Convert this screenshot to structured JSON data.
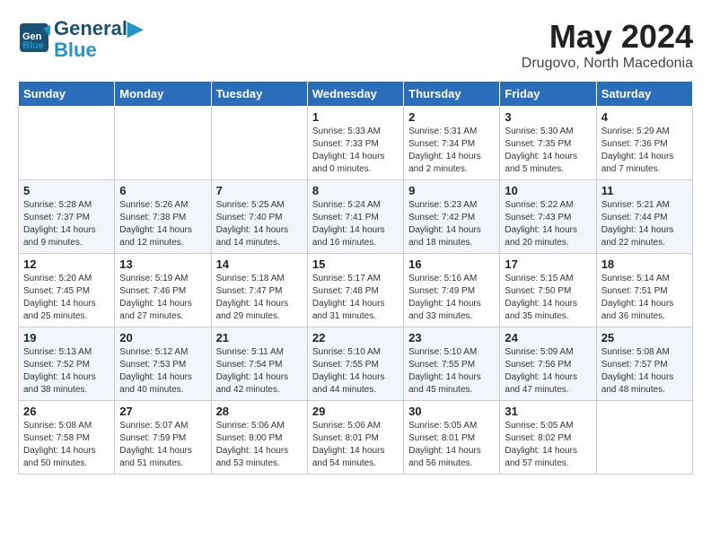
{
  "header": {
    "logo_line1": "General",
    "logo_line2": "Blue",
    "title": "May 2024",
    "subtitle": "Drugovo, North Macedonia"
  },
  "days_of_week": [
    "Sunday",
    "Monday",
    "Tuesday",
    "Wednesday",
    "Thursday",
    "Friday",
    "Saturday"
  ],
  "weeks": [
    {
      "days": [
        {
          "number": "",
          "detail": ""
        },
        {
          "number": "",
          "detail": ""
        },
        {
          "number": "",
          "detail": ""
        },
        {
          "number": "1",
          "detail": "Sunrise: 5:33 AM\nSunset: 7:33 PM\nDaylight: 14 hours and 0 minutes."
        },
        {
          "number": "2",
          "detail": "Sunrise: 5:31 AM\nSunset: 7:34 PM\nDaylight: 14 hours and 2 minutes."
        },
        {
          "number": "3",
          "detail": "Sunrise: 5:30 AM\nSunset: 7:35 PM\nDaylight: 14 hours and 5 minutes."
        },
        {
          "number": "4",
          "detail": "Sunrise: 5:29 AM\nSunset: 7:36 PM\nDaylight: 14 hours and 7 minutes."
        }
      ]
    },
    {
      "days": [
        {
          "number": "5",
          "detail": "Sunrise: 5:28 AM\nSunset: 7:37 PM\nDaylight: 14 hours and 9 minutes."
        },
        {
          "number": "6",
          "detail": "Sunrise: 5:26 AM\nSunset: 7:38 PM\nDaylight: 14 hours and 12 minutes."
        },
        {
          "number": "7",
          "detail": "Sunrise: 5:25 AM\nSunset: 7:40 PM\nDaylight: 14 hours and 14 minutes."
        },
        {
          "number": "8",
          "detail": "Sunrise: 5:24 AM\nSunset: 7:41 PM\nDaylight: 14 hours and 16 minutes."
        },
        {
          "number": "9",
          "detail": "Sunrise: 5:23 AM\nSunset: 7:42 PM\nDaylight: 14 hours and 18 minutes."
        },
        {
          "number": "10",
          "detail": "Sunrise: 5:22 AM\nSunset: 7:43 PM\nDaylight: 14 hours and 20 minutes."
        },
        {
          "number": "11",
          "detail": "Sunrise: 5:21 AM\nSunset: 7:44 PM\nDaylight: 14 hours and 22 minutes."
        }
      ]
    },
    {
      "days": [
        {
          "number": "12",
          "detail": "Sunrise: 5:20 AM\nSunset: 7:45 PM\nDaylight: 14 hours and 25 minutes."
        },
        {
          "number": "13",
          "detail": "Sunrise: 5:19 AM\nSunset: 7:46 PM\nDaylight: 14 hours and 27 minutes."
        },
        {
          "number": "14",
          "detail": "Sunrise: 5:18 AM\nSunset: 7:47 PM\nDaylight: 14 hours and 29 minutes."
        },
        {
          "number": "15",
          "detail": "Sunrise: 5:17 AM\nSunset: 7:48 PM\nDaylight: 14 hours and 31 minutes."
        },
        {
          "number": "16",
          "detail": "Sunrise: 5:16 AM\nSunset: 7:49 PM\nDaylight: 14 hours and 33 minutes."
        },
        {
          "number": "17",
          "detail": "Sunrise: 5:15 AM\nSunset: 7:50 PM\nDaylight: 14 hours and 35 minutes."
        },
        {
          "number": "18",
          "detail": "Sunrise: 5:14 AM\nSunset: 7:51 PM\nDaylight: 14 hours and 36 minutes."
        }
      ]
    },
    {
      "days": [
        {
          "number": "19",
          "detail": "Sunrise: 5:13 AM\nSunset: 7:52 PM\nDaylight: 14 hours and 38 minutes."
        },
        {
          "number": "20",
          "detail": "Sunrise: 5:12 AM\nSunset: 7:53 PM\nDaylight: 14 hours and 40 minutes."
        },
        {
          "number": "21",
          "detail": "Sunrise: 5:11 AM\nSunset: 7:54 PM\nDaylight: 14 hours and 42 minutes."
        },
        {
          "number": "22",
          "detail": "Sunrise: 5:10 AM\nSunset: 7:55 PM\nDaylight: 14 hours and 44 minutes."
        },
        {
          "number": "23",
          "detail": "Sunrise: 5:10 AM\nSunset: 7:55 PM\nDaylight: 14 hours and 45 minutes."
        },
        {
          "number": "24",
          "detail": "Sunrise: 5:09 AM\nSunset: 7:56 PM\nDaylight: 14 hours and 47 minutes."
        },
        {
          "number": "25",
          "detail": "Sunrise: 5:08 AM\nSunset: 7:57 PM\nDaylight: 14 hours and 48 minutes."
        }
      ]
    },
    {
      "days": [
        {
          "number": "26",
          "detail": "Sunrise: 5:08 AM\nSunset: 7:58 PM\nDaylight: 14 hours and 50 minutes."
        },
        {
          "number": "27",
          "detail": "Sunrise: 5:07 AM\nSunset: 7:59 PM\nDaylight: 14 hours and 51 minutes."
        },
        {
          "number": "28",
          "detail": "Sunrise: 5:06 AM\nSunset: 8:00 PM\nDaylight: 14 hours and 53 minutes."
        },
        {
          "number": "29",
          "detail": "Sunrise: 5:06 AM\nSunset: 8:01 PM\nDaylight: 14 hours and 54 minutes."
        },
        {
          "number": "30",
          "detail": "Sunrise: 5:05 AM\nSunset: 8:01 PM\nDaylight: 14 hours and 56 minutes."
        },
        {
          "number": "31",
          "detail": "Sunrise: 5:05 AM\nSunset: 8:02 PM\nDaylight: 14 hours and 57 minutes."
        },
        {
          "number": "",
          "detail": ""
        }
      ]
    }
  ]
}
